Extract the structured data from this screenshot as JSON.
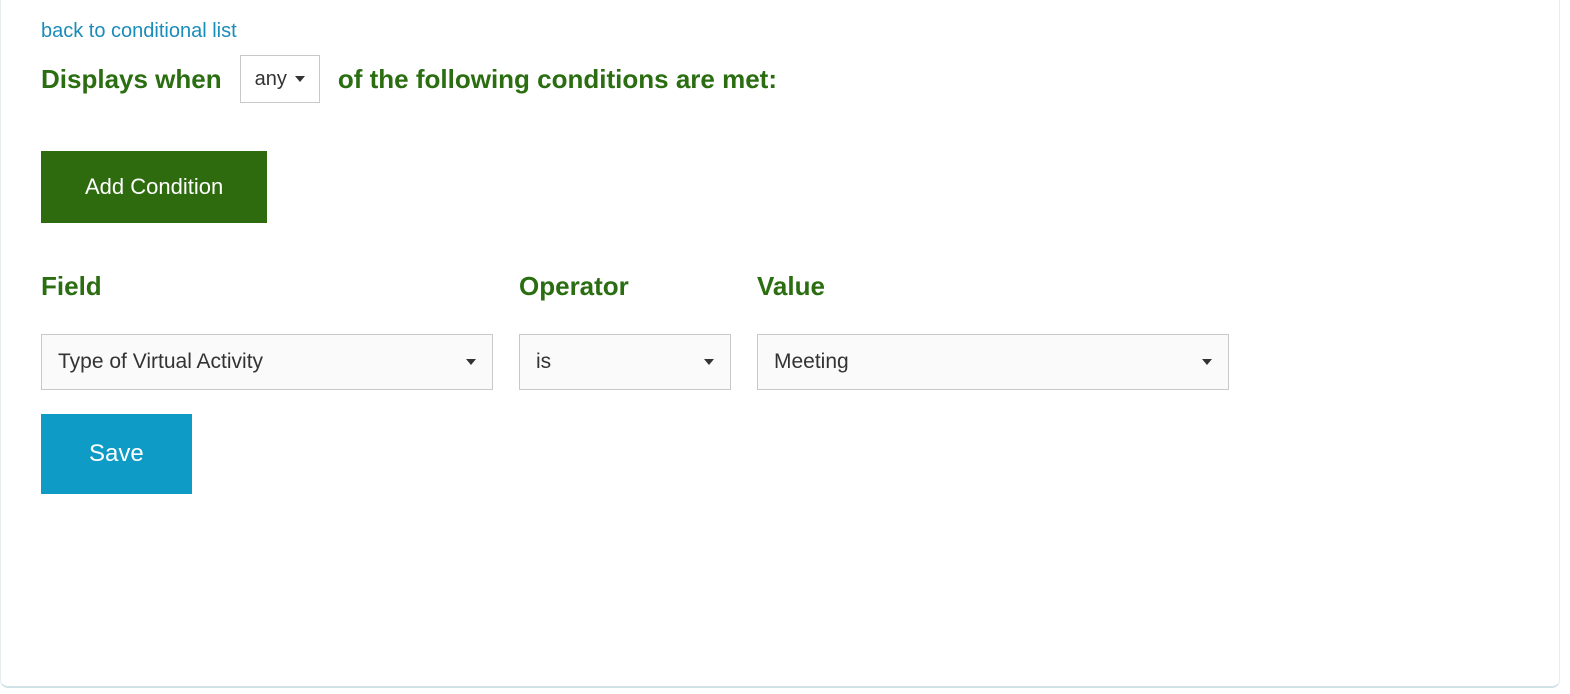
{
  "nav": {
    "back_link": "back to conditional list"
  },
  "sentence": {
    "prefix": "Displays when",
    "mode": "any",
    "suffix": "of the following conditions are met:"
  },
  "buttons": {
    "add_condition": "Add Condition",
    "save": "Save"
  },
  "headers": {
    "field": "Field",
    "operator": "Operator",
    "value": "Value"
  },
  "condition": {
    "field": "Type of Virtual Activity",
    "operator": "is",
    "value": "Meeting"
  }
}
